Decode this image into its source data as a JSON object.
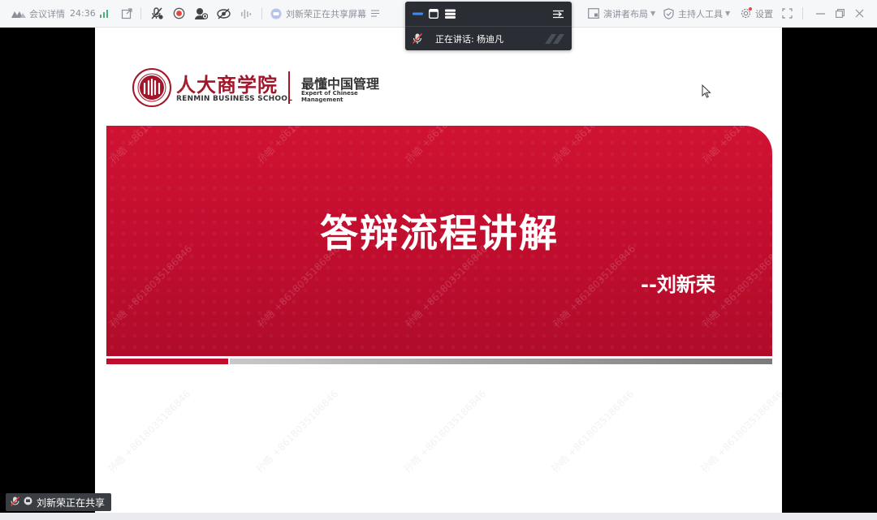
{
  "toolbar": {
    "meeting_info_label": "会议详情",
    "timer": "24:36",
    "sharing_label": "刘新荣正在共享屏幕",
    "presenter_layout_label": "演讲者布局",
    "host_tools_label": "主持人工具",
    "settings_label": "设置"
  },
  "speaking_panel": {
    "label": "正在讲话:",
    "name": "杨迪凡"
  },
  "slide": {
    "school_name": "人大商学院",
    "school_name_en": "RENMIN BUSINESS SCHOOL",
    "tagline": "最懂中国管理",
    "tagline_en_1": "Expert of Chinese",
    "tagline_en_2": "Management",
    "title": "答辩流程讲解",
    "author": "--刘新荣",
    "watermark": "孙皓 +8618035186846"
  },
  "share_badge": {
    "label": "刘新荣正在共享"
  },
  "colors": {
    "banner_red": "#c00d2e",
    "logo_red": "#a3162a",
    "toolbar_bg": "#f6f7f9",
    "panel_bg": "#2a2d33"
  }
}
